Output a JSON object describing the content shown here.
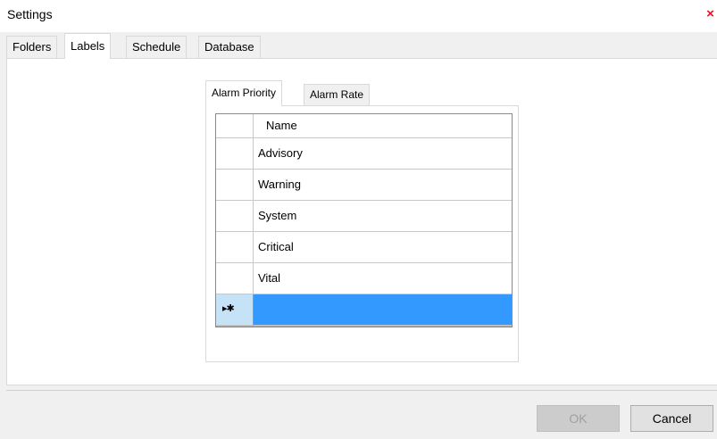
{
  "window": {
    "title": "Settings",
    "close_glyph": "×"
  },
  "outer_tabs": [
    {
      "label": "Folders",
      "selected": false
    },
    {
      "label": "Labels",
      "selected": true
    },
    {
      "label": "Schedule",
      "selected": false
    },
    {
      "label": "Database",
      "selected": false
    }
  ],
  "inner_tabs": [
    {
      "label": "Alarm Priority",
      "selected": true
    },
    {
      "label": "Alarm Rate",
      "selected": false
    }
  ],
  "grid": {
    "header": "Name",
    "rows": [
      "Advisory",
      "Warning",
      "System",
      "Critical",
      "Vital"
    ],
    "new_row_indicator": "▸✱",
    "new_row_color": "#3399ff"
  },
  "buttons": {
    "ok": "OK",
    "ok_enabled": false,
    "cancel": "Cancel"
  },
  "colors": {
    "accent": "#3399ff",
    "close": "#e81123"
  }
}
